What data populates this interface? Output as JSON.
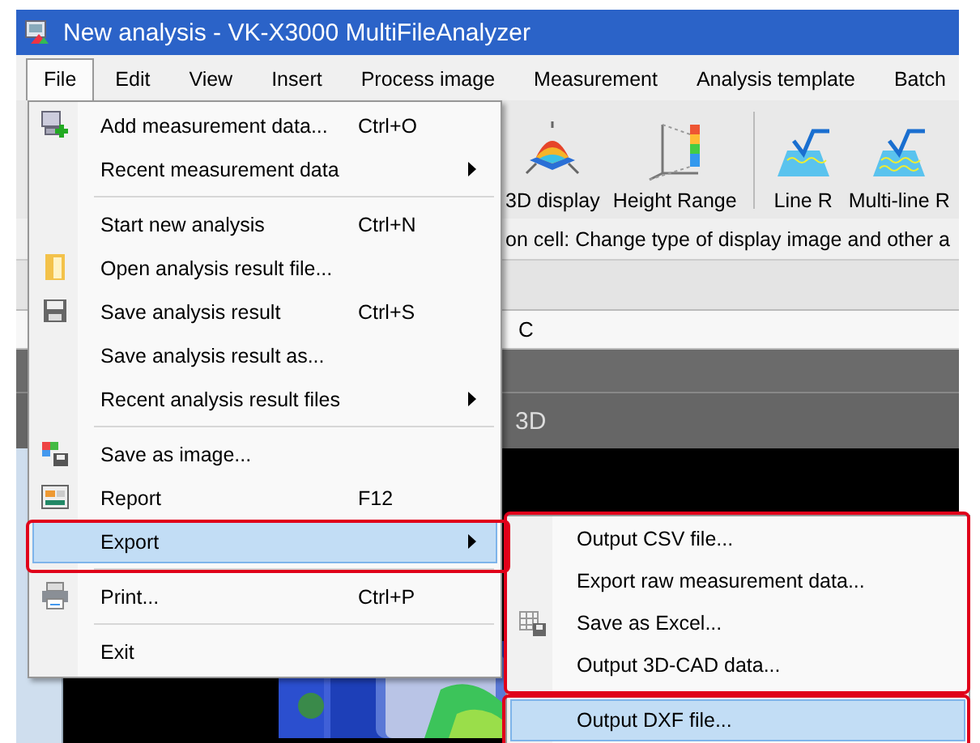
{
  "window": {
    "title": "New analysis - VK-X3000 MultiFileAnalyzer"
  },
  "menu_bar": [
    {
      "label": "File",
      "selected": true
    },
    {
      "label": "Edit",
      "selected": false
    },
    {
      "label": "View",
      "selected": false
    },
    {
      "label": "Insert",
      "selected": false
    },
    {
      "label": "Process image",
      "selected": false
    },
    {
      "label": "Measurement",
      "selected": false
    },
    {
      "label": "Analysis template",
      "selected": false
    },
    {
      "label": "Batch",
      "selected": false
    }
  ],
  "toolbar": [
    {
      "label": "3D display"
    },
    {
      "label": "Height Range"
    },
    {
      "label": "Line R"
    },
    {
      "label": "Multi-line R"
    }
  ],
  "info_text": "on cell: Change type of display image and other a",
  "grid": {
    "column_header": "C",
    "view_label": "3D"
  },
  "file_menu": [
    {
      "kind": "item",
      "label": "Add measurement data...",
      "shortcut": "Ctrl+O",
      "submenu": false,
      "selected": false
    },
    {
      "kind": "item",
      "label": "Recent measurement data",
      "submenu": true,
      "selected": false
    },
    {
      "kind": "separator"
    },
    {
      "kind": "item",
      "label": "Start new analysis",
      "shortcut": "Ctrl+N",
      "submenu": false,
      "selected": false
    },
    {
      "kind": "item",
      "label": "Open analysis result file...",
      "submenu": false,
      "selected": false
    },
    {
      "kind": "item",
      "label": "Save analysis result",
      "shortcut": "Ctrl+S",
      "submenu": false,
      "selected": false
    },
    {
      "kind": "item",
      "label": "Save analysis result as...",
      "submenu": false,
      "selected": false
    },
    {
      "kind": "item",
      "label": "Recent analysis result files",
      "submenu": true,
      "selected": false
    },
    {
      "kind": "separator"
    },
    {
      "kind": "item",
      "label": "Save as image...",
      "submenu": false,
      "selected": false
    },
    {
      "kind": "item",
      "label": "Report",
      "shortcut": "F12",
      "submenu": false,
      "selected": false
    },
    {
      "kind": "item",
      "label": "Export",
      "submenu": true,
      "selected": true
    },
    {
      "kind": "separator"
    },
    {
      "kind": "item",
      "label": "Print...",
      "shortcut": "Ctrl+P",
      "submenu": false,
      "selected": false
    },
    {
      "kind": "separator"
    },
    {
      "kind": "item",
      "label": "Exit",
      "submenu": false,
      "selected": false
    }
  ],
  "export_submenu": [
    {
      "label": "Output CSV file...",
      "selected": false
    },
    {
      "label": "Export raw measurement data...",
      "selected": false
    },
    {
      "label": "Save as Excel...",
      "selected": false
    },
    {
      "label": "Output 3D-CAD data...",
      "selected": false
    },
    {
      "label": "Output DXF file...",
      "selected": true
    }
  ]
}
